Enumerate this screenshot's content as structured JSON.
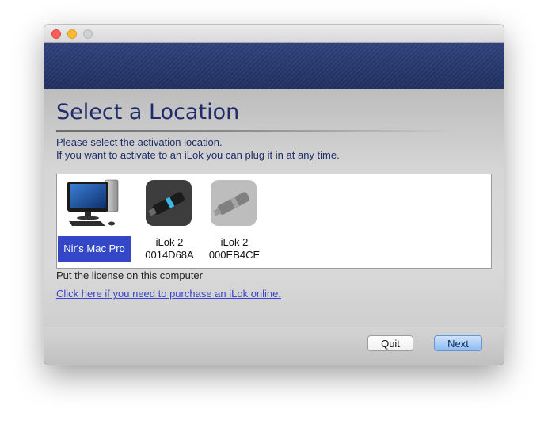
{
  "window": {
    "controls": [
      "close",
      "minimize",
      "zoom"
    ]
  },
  "header": {
    "title": "Select a Location",
    "instruction_line1": "Please select the activation location.",
    "instruction_line2": "If you want to activate to an iLok you can plug it in at any time."
  },
  "devices": [
    {
      "name": "Nir's Mac Pro",
      "icon": "mac-pro-computer-icon",
      "selected": true
    },
    {
      "name": "iLok 2",
      "serial": "0014D68A",
      "icon": "ilok-dongle-icon",
      "selected": false
    },
    {
      "name": "iLok 2",
      "serial": "000EB4CE",
      "icon": "ilok-dongle-icon",
      "selected": false
    }
  ],
  "selection_description": "Put the license on this computer",
  "purchase_link": "Click here if you need to purchase an iLok online.",
  "footer": {
    "quit_label": "Quit",
    "next_label": "Next"
  },
  "colors": {
    "banner": "#233468",
    "title": "#1f2b6b",
    "selection": "#3347c7",
    "link": "#3a44cc",
    "default_button": "#8cbcf2"
  }
}
